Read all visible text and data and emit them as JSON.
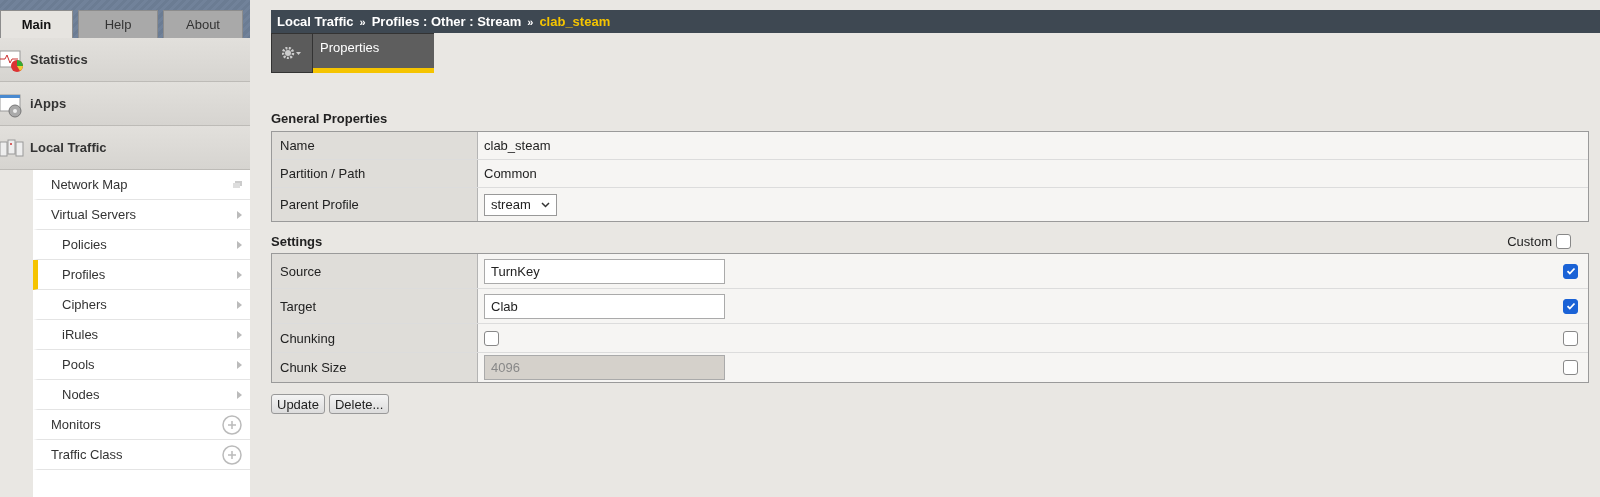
{
  "header_tabs": [
    {
      "label": "Main",
      "selected": true
    },
    {
      "label": "Help",
      "selected": false
    },
    {
      "label": "About",
      "selected": false
    }
  ],
  "sidebar": {
    "sections": [
      {
        "label": "Statistics",
        "kind": "stats"
      },
      {
        "label": "iApps",
        "kind": "apps"
      },
      {
        "label": "Local Traffic",
        "kind": "traffic"
      }
    ],
    "items": [
      {
        "label": "Network Map",
        "kind": "popout",
        "selected": false
      },
      {
        "label": "Virtual Servers",
        "kind": "arrow",
        "selected": false,
        "children": [
          {
            "label": "Policies",
            "kind": "arrow",
            "selected": false
          },
          {
            "label": "Profiles",
            "kind": "arrow",
            "selected": true
          },
          {
            "label": "Ciphers",
            "kind": "arrow",
            "selected": false
          },
          {
            "label": "iRules",
            "kind": "arrow",
            "selected": false
          },
          {
            "label": "Pools",
            "kind": "arrow",
            "selected": false
          },
          {
            "label": "Nodes",
            "kind": "arrow",
            "selected": false
          }
        ]
      },
      {
        "label": "Monitors",
        "kind": "add",
        "selected": false
      },
      {
        "label": "Traffic Class",
        "kind": "add",
        "selected": false
      }
    ]
  },
  "breadcrumb": {
    "path": [
      "Local Traffic",
      "Profiles : Other : Stream"
    ],
    "separator": "»",
    "current": "clab_steam"
  },
  "page_tabs": [
    {
      "label": "Properties",
      "selected": true
    }
  ],
  "general": {
    "title": "General Properties",
    "rows": [
      {
        "label": "Name",
        "kind": "text",
        "value": "clab_steam"
      },
      {
        "label": "Partition / Path",
        "kind": "text",
        "value": "Common"
      },
      {
        "label": "Parent Profile",
        "kind": "select",
        "value": "stream"
      }
    ]
  },
  "settings": {
    "title": "Settings",
    "custom_label": "Custom",
    "custom_checked": false,
    "rows": [
      {
        "label": "Source",
        "kind": "input",
        "value": "TurnKey",
        "disabled": false,
        "custom": true
      },
      {
        "label": "Target",
        "kind": "input",
        "value": "Clab",
        "disabled": false,
        "custom": true
      },
      {
        "label": "Chunking",
        "kind": "checkbox",
        "checked": false,
        "disabled": false,
        "custom": false
      },
      {
        "label": "Chunk Size",
        "kind": "input",
        "value": "4096",
        "disabled": true,
        "custom": false
      }
    ]
  },
  "buttons": [
    "Update",
    "Delete..."
  ]
}
